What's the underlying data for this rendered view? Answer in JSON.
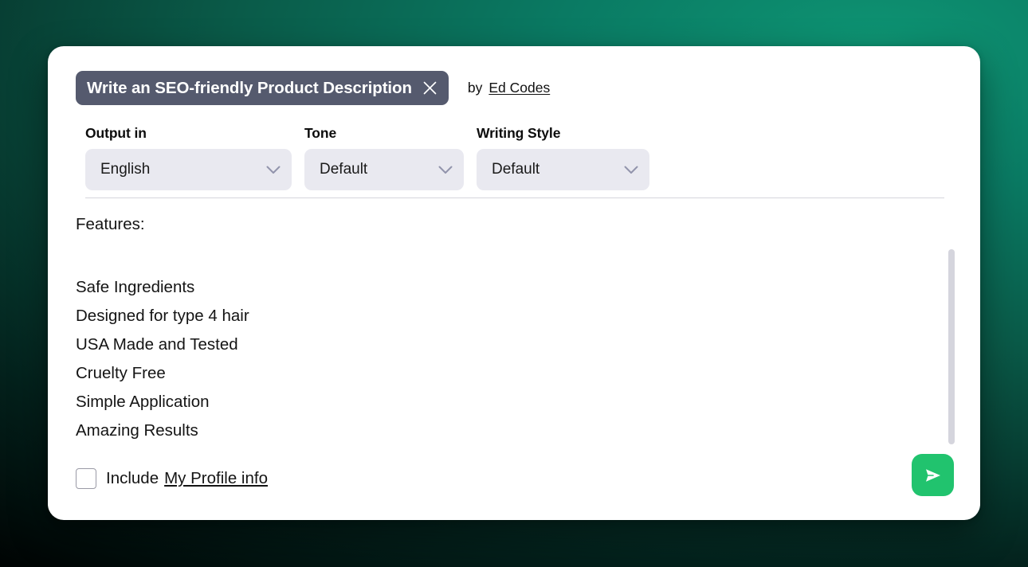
{
  "header": {
    "title": "Write an SEO-friendly Product Description",
    "close_icon": "close-icon",
    "by_label": "by",
    "author": "Ed Codes"
  },
  "selects": [
    {
      "label": "Output in",
      "value": "English",
      "icon": "chevron-down-icon"
    },
    {
      "label": "Tone",
      "value": "Default",
      "icon": "chevron-down-icon"
    },
    {
      "label": "Writing Style",
      "value": "Default",
      "icon": "chevron-down-icon"
    }
  ],
  "body": {
    "heading": "Features:",
    "lines": [
      "Safe Ingredients",
      "Designed for type 4 hair",
      "USA Made and Tested",
      "Cruelty Free",
      "Simple Application",
      "Amazing Results"
    ]
  },
  "footer": {
    "include_label": "Include",
    "profile_link": "My Profile info",
    "checkbox_checked": false,
    "send_icon": "send-icon"
  },
  "colors": {
    "pill_background": "#555a6e",
    "select_background": "#e9e9f0",
    "send_button": "#21c36e",
    "panel_background": "#ffffff",
    "divider": "#d6d6dc",
    "scrollbar_thumb": "#d5d5dd"
  }
}
